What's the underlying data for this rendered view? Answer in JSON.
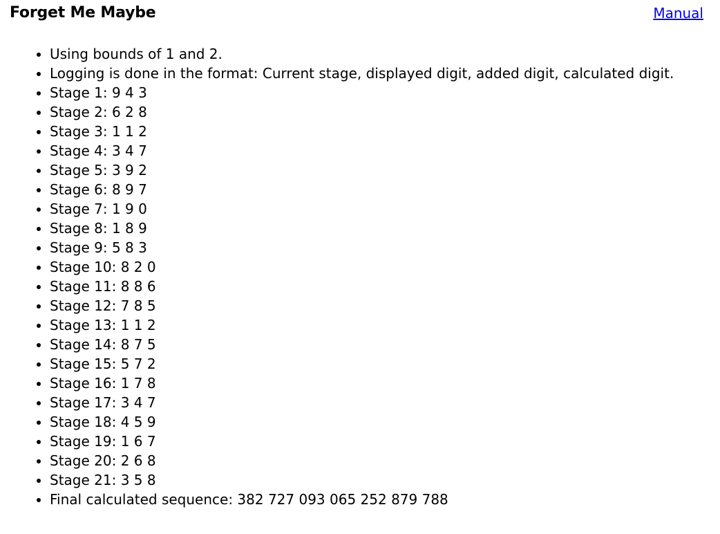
{
  "header": {
    "title": "Forget Me Maybe",
    "manual_link": "Manual"
  },
  "log": {
    "items": [
      "Using bounds of 1 and 2.",
      "Logging is done in the format: Current stage, displayed digit, added digit, calculated digit.",
      "Stage 1: 9 4 3",
      "Stage 2: 6 2 8",
      "Stage 3: 1 1 2",
      "Stage 4: 3 4 7",
      "Stage 5: 3 9 2",
      "Stage 6: 8 9 7",
      "Stage 7: 1 9 0",
      "Stage 8: 1 8 9",
      "Stage 9: 5 8 3",
      "Stage 10: 8 2 0",
      "Stage 11: 8 8 6",
      "Stage 12: 7 8 5",
      "Stage 13: 1 1 2",
      "Stage 14: 8 7 5",
      "Stage 15: 5 7 2",
      "Stage 16: 1 7 8",
      "Stage 17: 3 4 7",
      "Stage 18: 4 5 9",
      "Stage 19: 1 6 7",
      "Stage 20: 2 6 8",
      "Stage 21: 3 5 8",
      "Final calculated sequence: 382 727 093 065 252 879 788"
    ]
  }
}
